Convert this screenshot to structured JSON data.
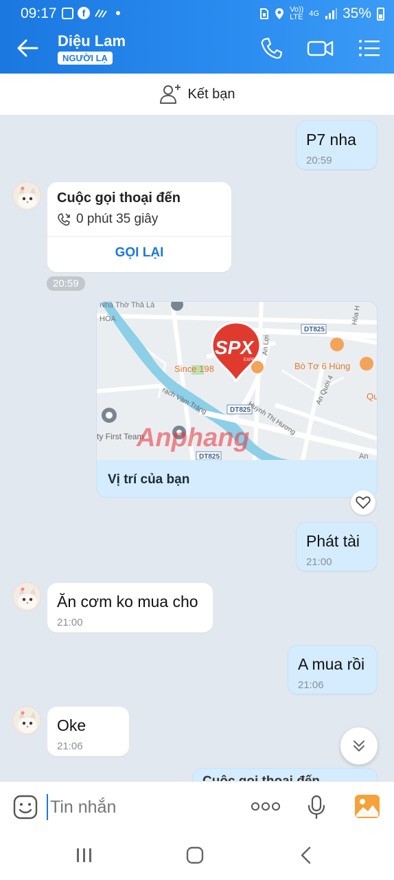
{
  "status": {
    "time": "09:17",
    "battery": "35%",
    "network": "4G",
    "volte_top": "Vo))",
    "volte_bottom": "LTE"
  },
  "header": {
    "contact_name": "Diệu Lam",
    "badge": "NGƯỜI LẠ"
  },
  "add_friend": {
    "label": "Kết bạn"
  },
  "messages": {
    "m1": {
      "text": "P7 nha",
      "time": "20:59"
    },
    "call": {
      "title": "Cuộc gọi thoại đến",
      "duration": "0 phút 35 giây",
      "action": "GỌI LẠI",
      "time": "20:59"
    },
    "location": {
      "label": "Vị trí của bạn",
      "map_labels": {
        "place1": "Since 198",
        "place2": "Bò Tơ 6 Hùng",
        "road1": "DT825",
        "road2": "DT825",
        "road3": "DT825",
        "street1": "Huỳnh Thị Hương",
        "street2": "rạch Vàm Tráng",
        "street3": "An Quới 4",
        "street4": "An Lợi",
        "street5": "Hòa H",
        "place3": "Nhà Thờ Thả Lá",
        "place4": "HÒA",
        "place5": "ty First Team",
        "place6": "Qu",
        "place7": "An",
        "logo": "SPX",
        "logo_sub": "EXPRESS",
        "watermark": "Anphang"
      }
    },
    "m2": {
      "text": "Phát tài",
      "time": "21:00"
    },
    "m3": {
      "text": "Ăn cơm ko mua cho",
      "time": "21:00"
    },
    "m4": {
      "text": "A mua rồi",
      "time": "21:06"
    },
    "m5": {
      "text": "Oke",
      "time": "21:06"
    },
    "m6_partial": {
      "text": "Cuộc gọi thoại đến"
    }
  },
  "input": {
    "placeholder": "Tin nhắn"
  },
  "colors": {
    "accent": "#1a78e0",
    "me_bubble": "#d4ecfd",
    "bg": "#e2e8ef"
  }
}
